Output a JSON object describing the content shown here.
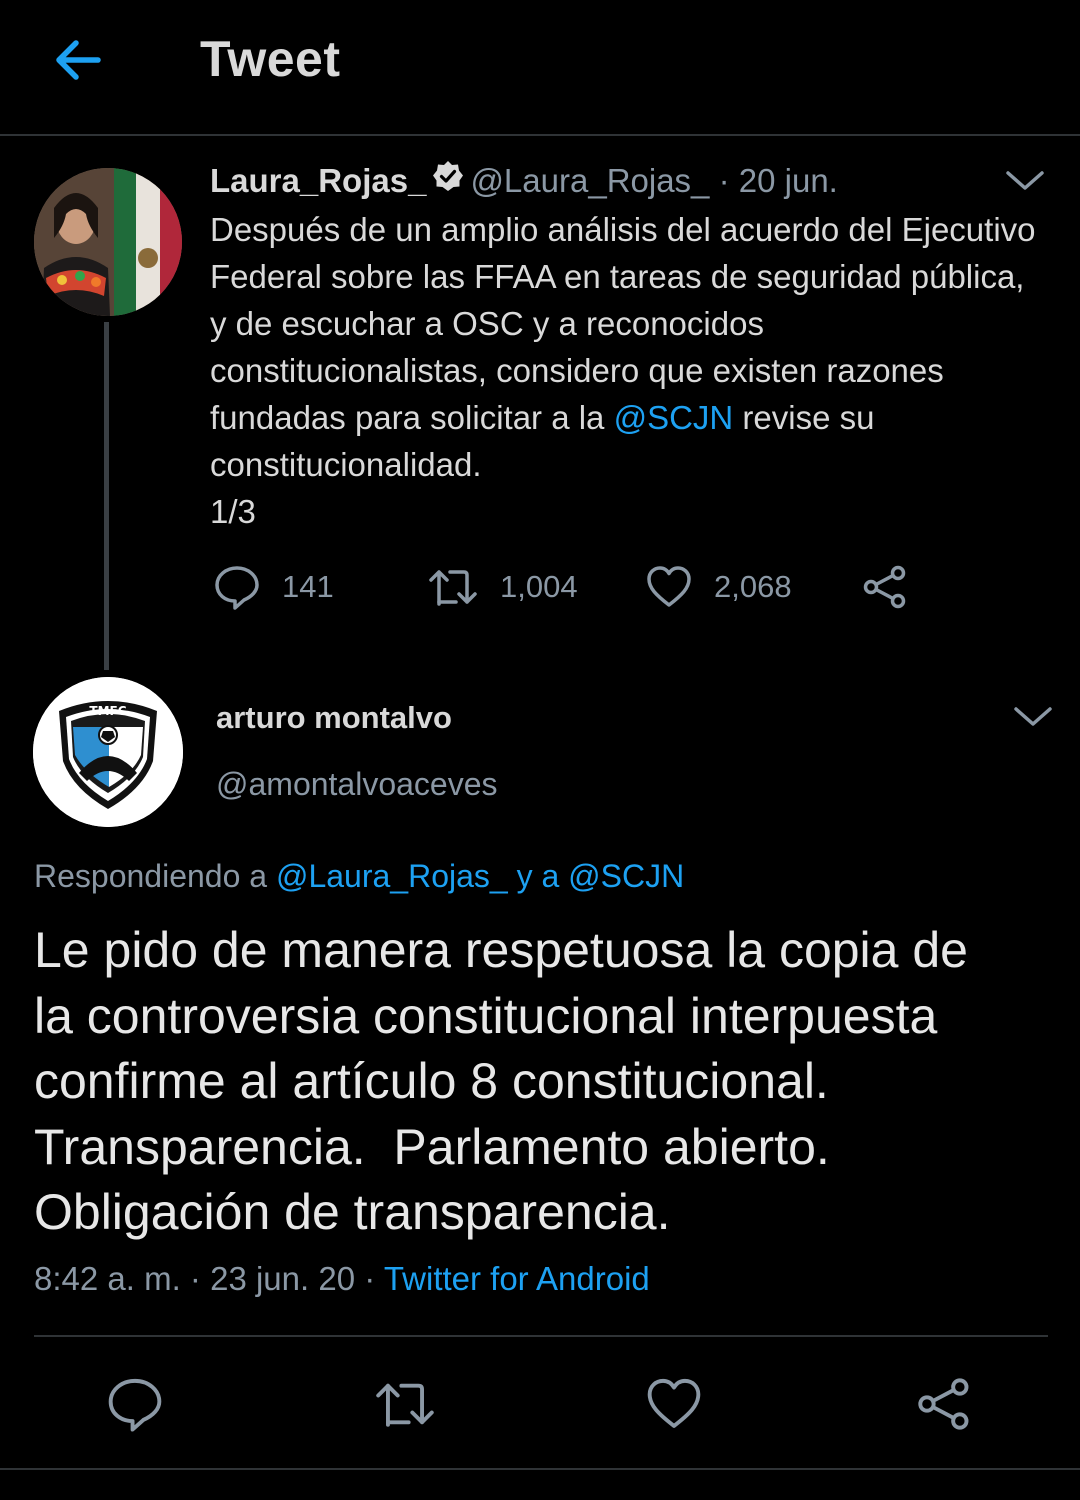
{
  "header": {
    "title": "Tweet",
    "back_icon": "arrow-left-icon",
    "accent": "#1da1f2"
  },
  "parent_tweet": {
    "name": "Laura_Rojas_",
    "verified": true,
    "handle": "@Laura_Rojas_",
    "separator": "·",
    "date": "20 jun.",
    "text_before_link": "Después de un amplio análisis del acuerdo del Ejecutivo Federal sobre las FFAA en tareas de seguridad pública, y de escuchar a OSC y a reconocidos constitucionalistas, considero que existen razones fundadas para solicitar a la ",
    "link": "@SCJN",
    "text_after_link": " revise su constitucionalidad.",
    "thread_marker": "1/3",
    "replies": "141",
    "retweets": "1,004",
    "likes": "2,068"
  },
  "reply_tweet": {
    "name": "arturo montalvo",
    "handle": "@amontalvoaceves",
    "avatar_logo_text": "TMFC",
    "replying_prefix": "Respondiendo a ",
    "replying_users": "@Laura_Rojas_ y a @SCJN",
    "lines": [
      "Le pido de manera respetuosa la copia de",
      "la controversia constitucional interpuesta",
      "confirme al artículo 8 constitucional.",
      "Transparencia.  Parlamento abierto.",
      "Obligación de transparencia."
    ],
    "time": "8:42 a. m.",
    "meta_separator": "·",
    "date": "23 jun. 20",
    "source": "Twitter for Android"
  },
  "colors": {
    "background": "#000000",
    "text": "#d9d9d9",
    "muted": "#8b98a5",
    "link": "#1da1f2",
    "divider": "#2f3336"
  }
}
